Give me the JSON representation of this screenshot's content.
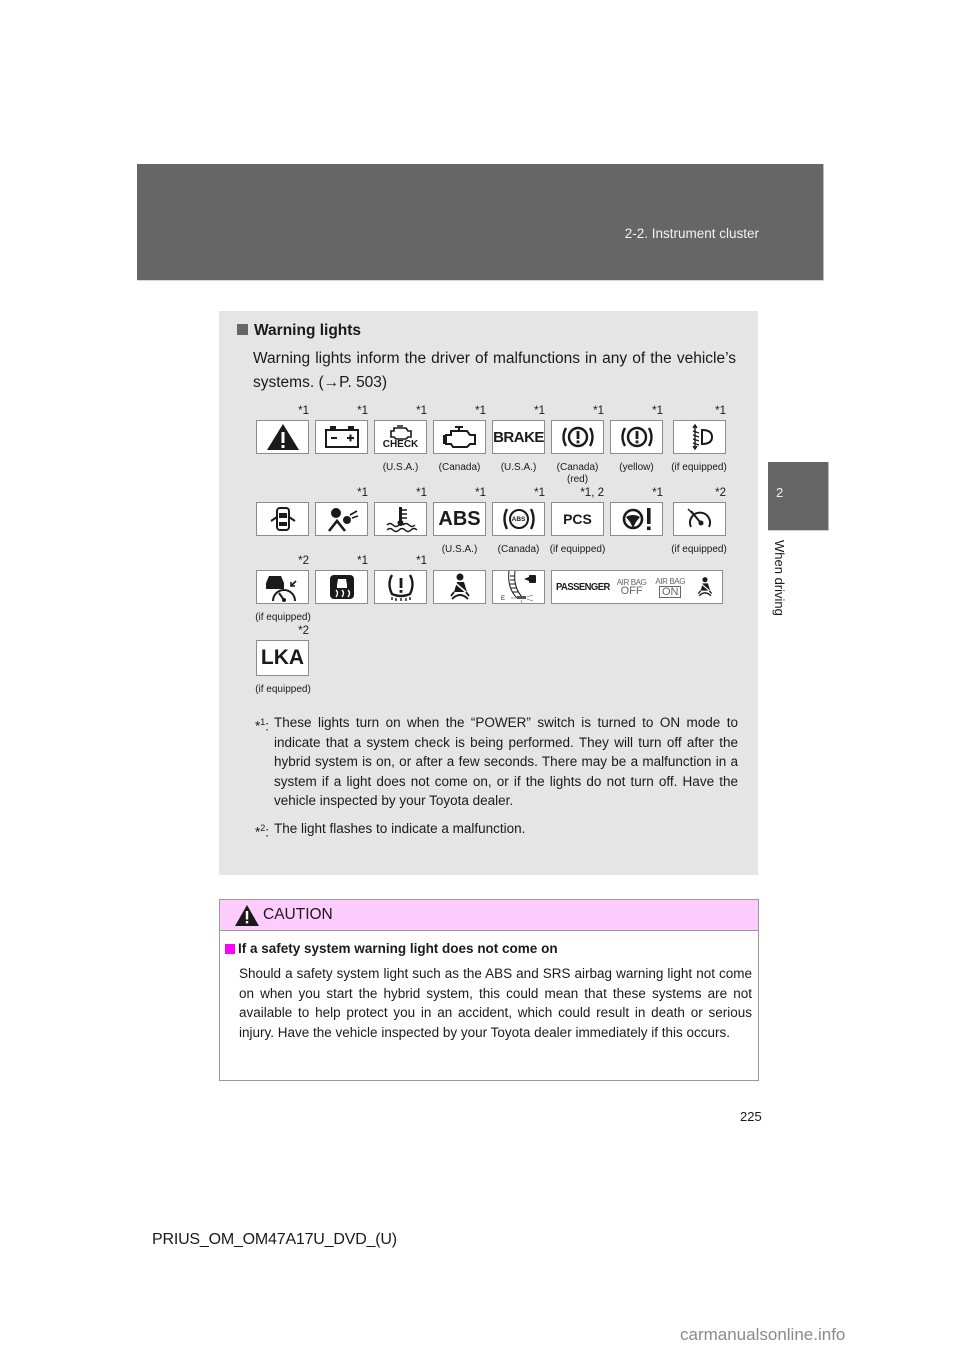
{
  "header": {
    "section": "2-2. Instrument cluster"
  },
  "side_tab": {
    "chapter_number": "2",
    "chapter_label": "When driving"
  },
  "warning_lights": {
    "heading": "Warning lights",
    "intro": "Warning lights inform the driver of malfunctions in any of the vehicle’s systems. (→P. 503)",
    "rows": [
      [
        {
          "icon": "master-warning-icon",
          "mark": "*1",
          "caption": ""
        },
        {
          "icon": "charging-system-icon",
          "mark": "*1",
          "caption": ""
        },
        {
          "icon": "check-engine-icon",
          "mark": "*1",
          "caption": "(U.S.A.)",
          "text": "CHECK"
        },
        {
          "icon": "engine-icon",
          "mark": "*1",
          "caption": "(Canada)"
        },
        {
          "icon": "brake-text-icon",
          "mark": "*1",
          "caption": "(U.S.A.)",
          "text": "BRAKE"
        },
        {
          "icon": "brake-system-red-icon",
          "mark": "*1",
          "caption": "(Canada)",
          "caption2": "(red)"
        },
        {
          "icon": "brake-system-yellow-icon",
          "mark": "*1",
          "caption": "(yellow)"
        },
        {
          "icon": "headlight-leveling-icon",
          "mark": "*1",
          "caption": "(if equipped)"
        }
      ],
      [
        {
          "icon": "open-door-icon",
          "mark": "",
          "caption": ""
        },
        {
          "icon": "srs-airbag-icon",
          "mark": "*1",
          "caption": ""
        },
        {
          "icon": "coolant-temperature-icon",
          "mark": "*1",
          "caption": ""
        },
        {
          "icon": "abs-text-icon",
          "mark": "*1",
          "caption": "(U.S.A.)",
          "text": "ABS"
        },
        {
          "icon": "abs-circle-icon",
          "mark": "*1",
          "caption": "(Canada)",
          "text": "ABS"
        },
        {
          "icon": "pcs-icon",
          "mark": "*1, 2",
          "caption": "(if equipped)",
          "text": "PCS"
        },
        {
          "icon": "power-steering-icon",
          "mark": "*1",
          "caption": ""
        },
        {
          "icon": "cruise-control-icon",
          "mark": "*2",
          "caption": "(if equipped)"
        }
      ],
      [
        {
          "icon": "radar-cruise-icon",
          "mark": "*2",
          "caption": "(if equipped)"
        },
        {
          "icon": "slip-indicator-icon",
          "mark": "*1",
          "caption": ""
        },
        {
          "icon": "tire-pressure-icon",
          "mark": "*1",
          "caption": ""
        },
        {
          "icon": "seatbelt-reminder-icon",
          "mark": "",
          "caption": ""
        },
        {
          "icon": "low-fuel-icon",
          "mark": "",
          "caption": ""
        },
        {
          "icon": "passenger-airbag-indicator",
          "mark": "",
          "caption": "",
          "passenger": "PASSENGER",
          "airbag": "AIR BAG",
          "off": "OFF",
          "on": "ON"
        }
      ],
      [
        {
          "icon": "lka-icon",
          "mark": "*2",
          "caption": "(if equipped)",
          "text": "LKA"
        }
      ]
    ],
    "notes": [
      {
        "mark": "*",
        "sup": "1",
        "text": "These lights turn on when the “POWER” switch is turned to ON mode to indicate that a system check is being performed. They will turn off after the hybrid system is on, or after a few seconds. There may be a malfunction in a system if a light does not come on, or if the lights do not turn off. Have the vehicle inspected by your Toyota dealer."
      },
      {
        "mark": "*",
        "sup": "2",
        "text": "The light flashes to indicate a malfunction."
      }
    ]
  },
  "caution": {
    "title": "CAUTION",
    "subheading": "If a safety system warning light does not come on",
    "body": "Should a safety system light such as the ABS and SRS airbag warning light not come on when you start the hybrid system, this could mean that these systems are not available to help protect you in an accident, which could result in death or serious injury. Have the vehicle inspected by your Toyota dealer immediately if this occurs."
  },
  "footer": {
    "page_number": "225",
    "doc_code": "PRIUS_OM_OM47A17U_DVD_(U)",
    "watermark": "carmanualsonline.info"
  },
  "colors": {
    "header_gray": "#666666",
    "panel_gray": "#e5e5e5",
    "caution_pink": "#ffccff",
    "caution_magenta": "#ff00ff"
  }
}
